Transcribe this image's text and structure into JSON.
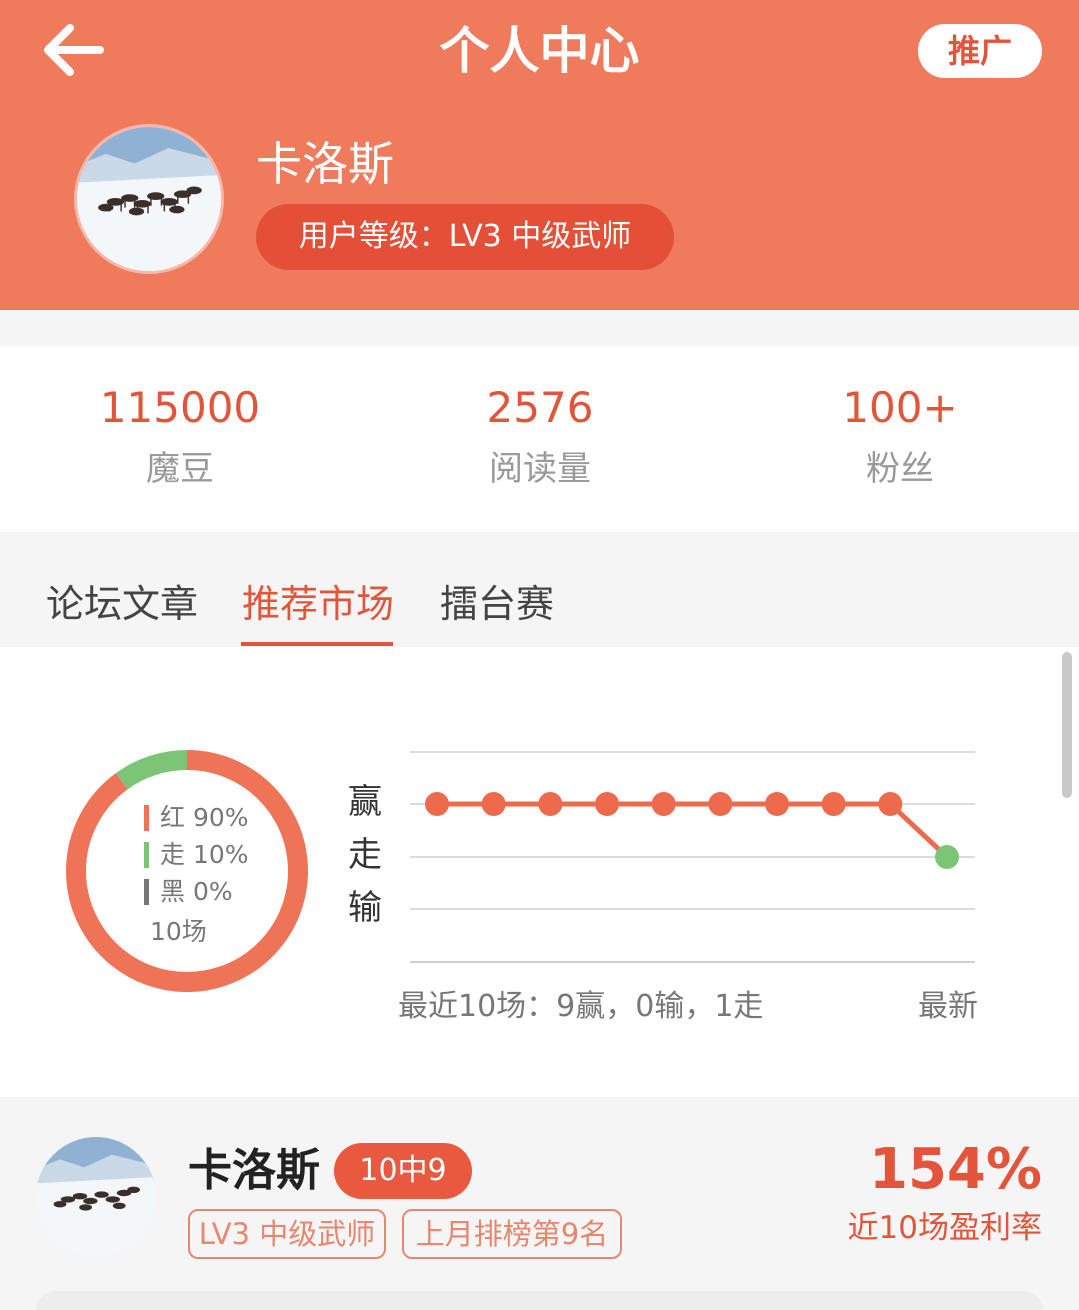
{
  "header": {
    "title": "个人中心",
    "promote_label": "推广",
    "back_icon": "arrow-left-icon",
    "bg_color": "#ef7a5c"
  },
  "profile": {
    "name": "卡洛斯",
    "level_badge": "用户等级：LV3 中级武师",
    "avatar_icon": "reindeer-snow-avatar"
  },
  "stats": [
    {
      "value": "115000",
      "label": "魔豆"
    },
    {
      "value": "2576",
      "label": "阅读量"
    },
    {
      "value": "100+",
      "label": "粉丝"
    }
  ],
  "tabs": [
    {
      "label": "论坛文章",
      "active": false
    },
    {
      "label": "推荐市场",
      "active": true
    },
    {
      "label": "擂台赛",
      "active": false
    }
  ],
  "chart_data": [
    {
      "type": "pie",
      "donut": true,
      "categories": [
        "红",
        "走",
        "黑"
      ],
      "values": [
        90,
        10,
        0
      ],
      "labels": [
        "红 90%",
        "走 10%",
        "黑 0%"
      ],
      "colors": [
        "#ee7357",
        "#7cc576",
        "#777777"
      ],
      "total_label": "10场"
    },
    {
      "type": "line",
      "y_categories": [
        "赢",
        "走",
        "输"
      ],
      "values": [
        "赢",
        "赢",
        "赢",
        "赢",
        "赢",
        "赢",
        "赢",
        "赢",
        "赢",
        "走"
      ],
      "point_colors": [
        "#ee6a4c",
        "#ee6a4c",
        "#ee6a4c",
        "#ee6a4c",
        "#ee6a4c",
        "#ee6a4c",
        "#ee6a4c",
        "#ee6a4c",
        "#ee6a4c",
        "#7cc576"
      ],
      "line_color": "#ee6a4c",
      "xlabel": "最近10场：9赢，0输，1走",
      "x_end_label": "最新",
      "grid": true
    }
  ],
  "card": {
    "name": "卡洛斯",
    "hit_badge": "10中9",
    "tags": [
      "LV3 中级武师",
      "上月排榜第9名"
    ],
    "profit_value": "154%",
    "profit_label": "近10场盈利率"
  }
}
